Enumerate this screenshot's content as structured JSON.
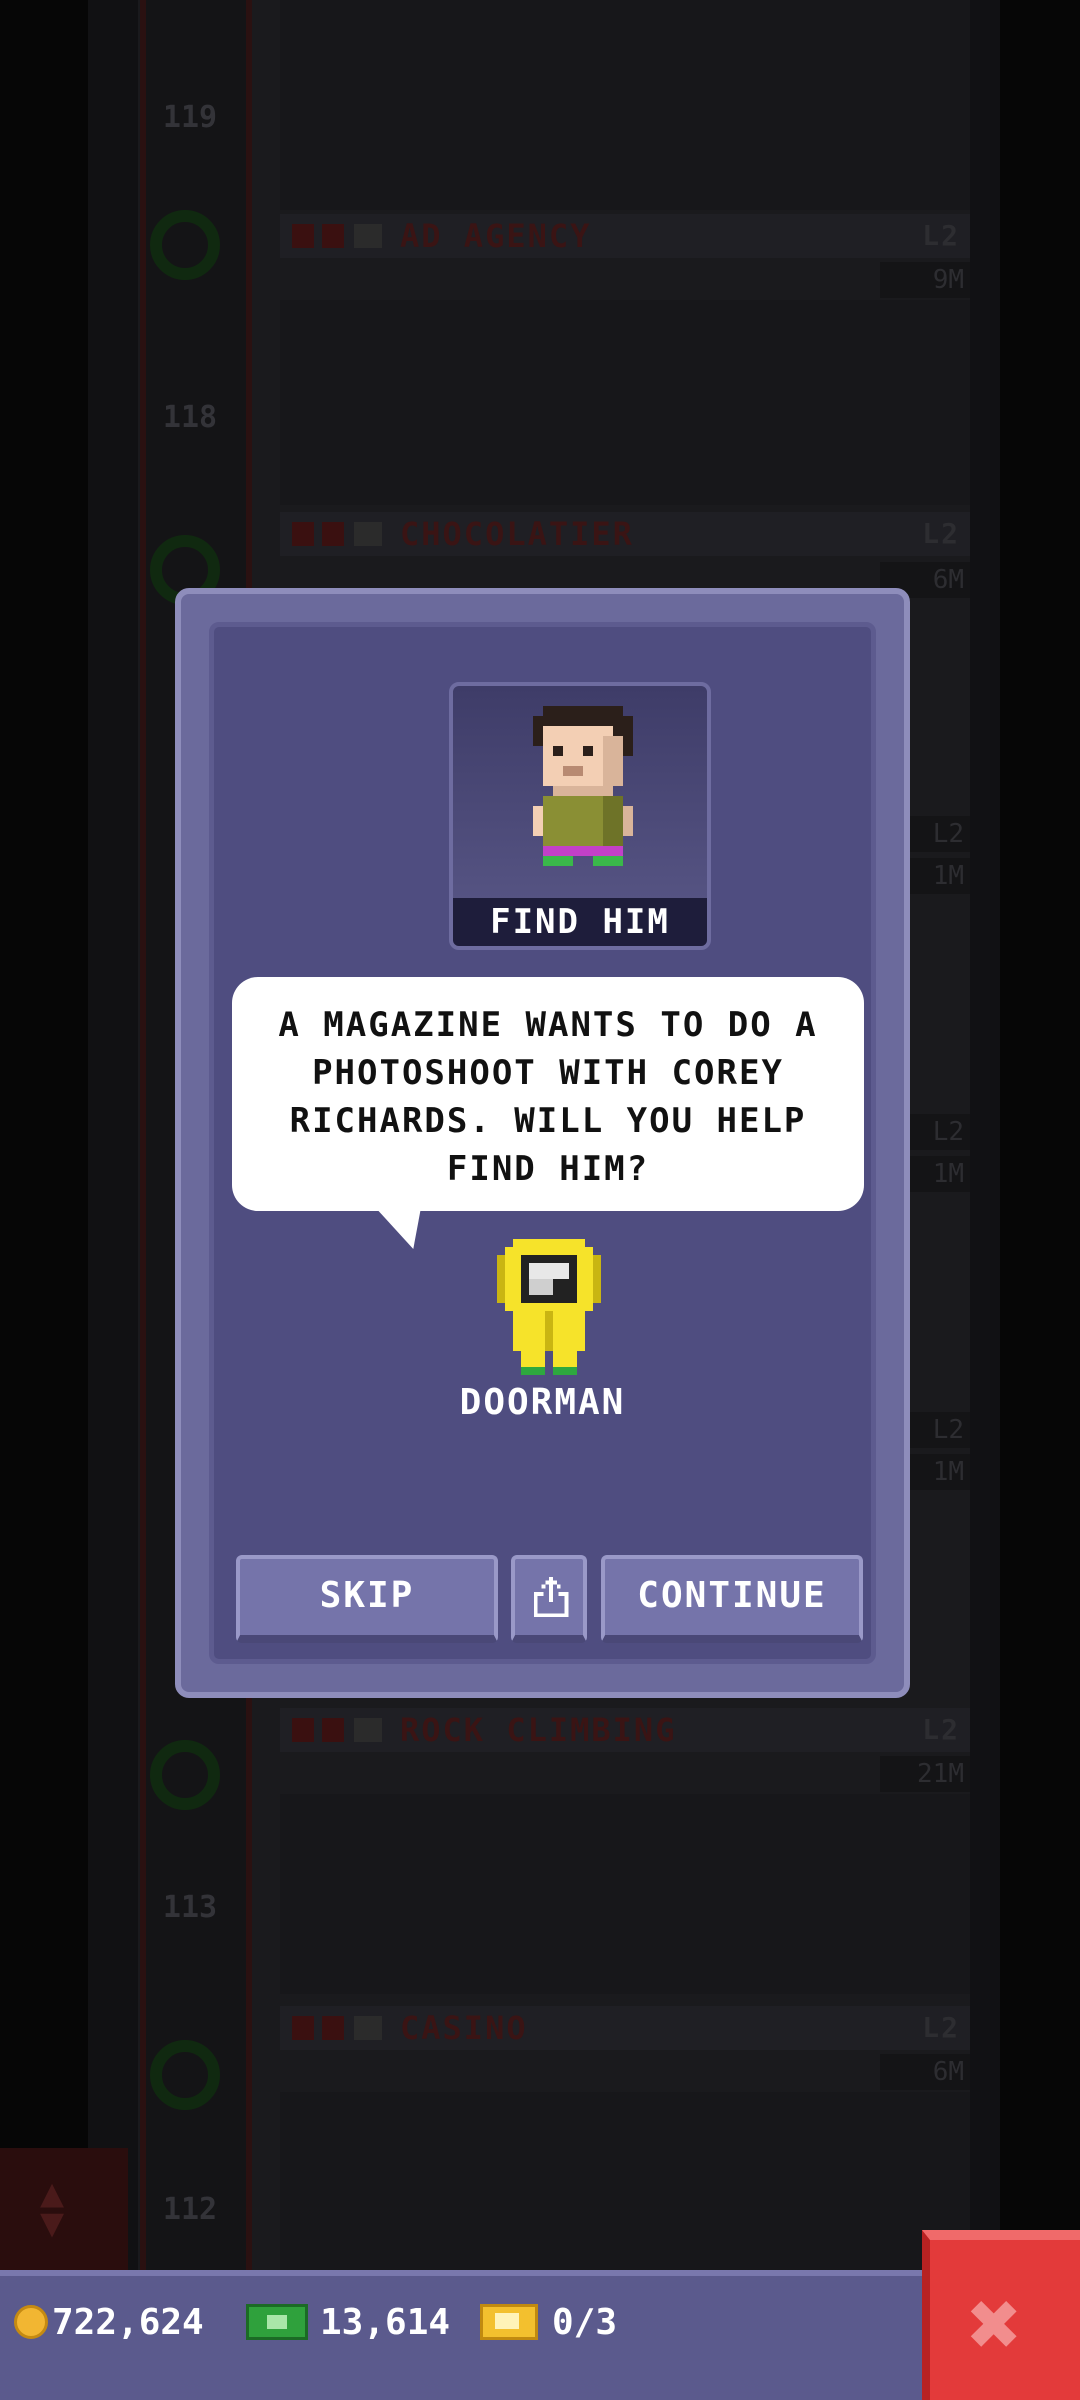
{
  "background": {
    "floor_numbers": [
      "119",
      "118",
      "113",
      "112"
    ],
    "floors": [
      {
        "name": "AD AGENCY",
        "level": "L2",
        "cost": "9M"
      },
      {
        "name": "CHOCOLATIER",
        "level": "L2",
        "cost": "6M"
      },
      {
        "name": "ROCK CLIMBING",
        "level": "L2",
        "cost": "21M"
      },
      {
        "name": "CASINO",
        "level": "L2",
        "cost": "6M"
      }
    ],
    "partial_labels": [
      "L2",
      "1M",
      "L2",
      "1M",
      "L2",
      "1M"
    ]
  },
  "dialog": {
    "portrait_caption": "FIND HIM",
    "message": "A MAGAZINE WANTS TO DO A PHOTOSHOOT WITH COREY RICHARDS. WILL YOU HELP FIND HIM?",
    "speaker": "DOORMAN",
    "buttons": {
      "skip": "SKIP",
      "continue": "CONTINUE"
    }
  },
  "resources": {
    "coins": "722,624",
    "bux": "13,614",
    "tickets": "0/3"
  },
  "icons": {
    "share": "share-icon",
    "close": "close-icon",
    "coin": "coin-icon",
    "bux": "bux-icon",
    "ticket": "ticket-icon",
    "elevator": "elevator-arrows-icon"
  },
  "colors": {
    "dialog_bg": "#4f4d80",
    "button": "#7574aa",
    "close": "#e33a3a",
    "bottom_bar": "#5b5a8d"
  }
}
